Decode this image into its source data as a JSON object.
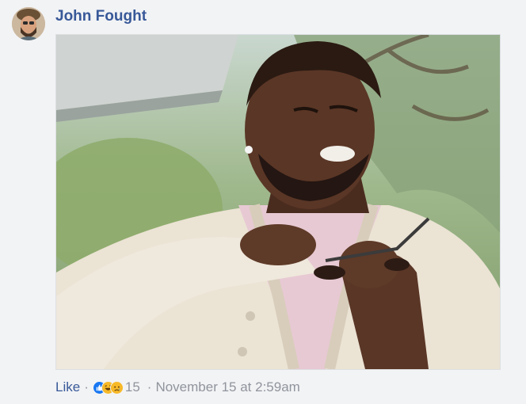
{
  "comment": {
    "author": "John Fought",
    "like_label": "Like",
    "separator": "·",
    "reaction_icons": [
      "like-reaction-icon",
      "haha-reaction-icon",
      "sad-reaction-icon"
    ],
    "reaction_count": "15",
    "timestamp": "November 15 at 2:59am"
  },
  "colors": {
    "page_background": "#f2f3f5",
    "link": "#385898",
    "meta_text": "#90949c",
    "like_reaction": "#1877f2",
    "emoji_reaction": "#f7b928"
  }
}
